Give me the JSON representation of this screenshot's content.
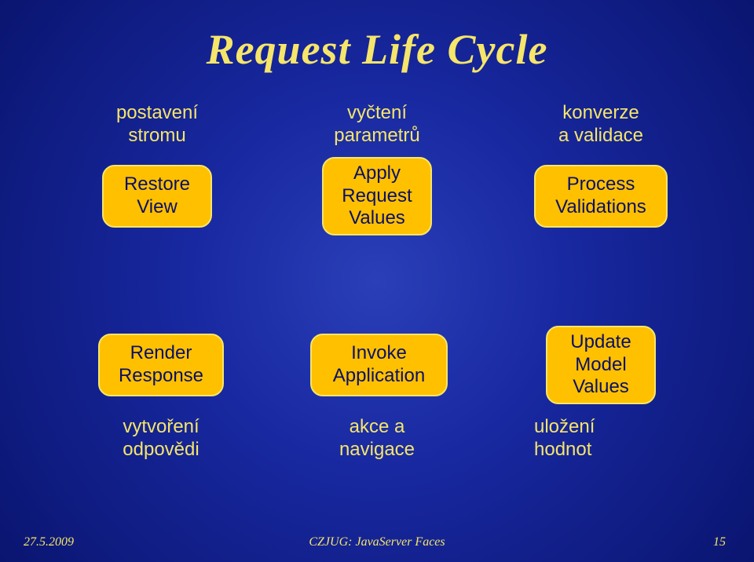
{
  "title": "Request Life Cycle",
  "top_labels": {
    "col1": "postavení\nstromu",
    "col2": "vyčtení\nparametrů",
    "col3": "konverze\na validace"
  },
  "top_boxes": {
    "restore_view": "Restore\nView",
    "apply_request": "Apply\nRequest\nValues",
    "process_validations": "Process\nValidations"
  },
  "bottom_boxes": {
    "render_response": "Render\nResponse",
    "invoke_application": "Invoke\nApplication",
    "update_model": "Update\nModel\nValues"
  },
  "bottom_labels": {
    "col1": "vytvoření\nodpovědi",
    "col2": "akce a\nnavigace",
    "col3": "uložení\nhodnot"
  },
  "footer": {
    "date": "27.5.2009",
    "center": "CZJUG: JavaServer Faces",
    "page": "15"
  }
}
